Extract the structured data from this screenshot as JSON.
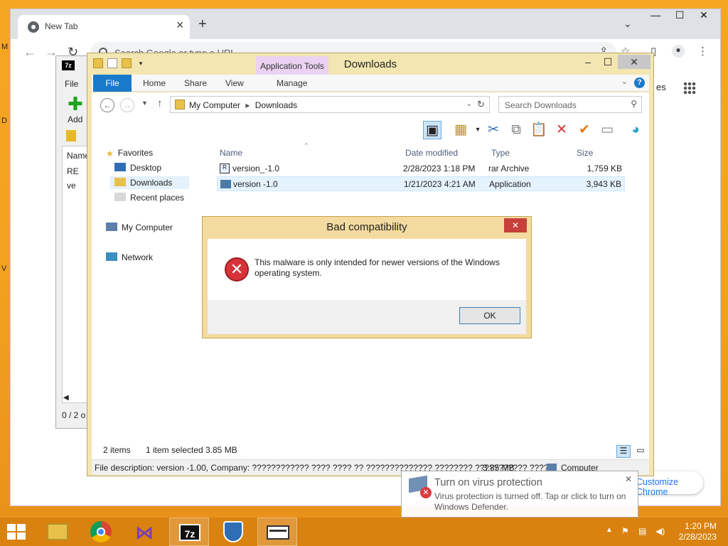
{
  "desktop": {
    "edge_letters": [
      "M",
      "D",
      "V"
    ]
  },
  "chrome": {
    "tab_title": "New Tab",
    "newtab_symbol": "+",
    "omnibox_placeholder": "Search Google or type a URL",
    "images_fragment": "es",
    "customize_label": "Customize Chrome"
  },
  "sevenzip": {
    "logo": "7z",
    "menu_file": "File",
    "add_label": "Add",
    "list_header": "Name",
    "row1": "RE",
    "row2": "ve",
    "status": "0 / 2 o"
  },
  "explorer": {
    "title": "Downloads",
    "context_tab": "Application Tools",
    "ribbon_tabs": {
      "file": "File",
      "home": "Home",
      "share": "Share",
      "view": "View",
      "manage": "Manage"
    },
    "breadcrumbs": [
      "My Computer",
      "Downloads"
    ],
    "search_placeholder": "Search Downloads",
    "nav": {
      "favorites": "Favorites",
      "desktop": "Desktop",
      "downloads": "Downloads",
      "recent": "Recent places",
      "computer": "My Computer",
      "network": "Network"
    },
    "columns": {
      "name": "Name",
      "date": "Date modified",
      "type": "Type",
      "size": "Size"
    },
    "files": [
      {
        "name": "version_-1.0",
        "date": "2/28/2023 1:18 PM",
        "type": "rar Archive",
        "size": "1,759 KB"
      },
      {
        "name": "version -1.0",
        "date": "1/21/2023 4:21 AM",
        "type": "Application",
        "size": "3,943 KB"
      }
    ],
    "status": {
      "items": "2 items",
      "selected": "1 item selected",
      "size": "3.85 MB"
    },
    "details": {
      "description": "File description: version -1.00, Company: ???????????? ???? ???? ?? ?????????????? ???????? ??????????? ?????",
      "size": "3.85 MB",
      "location": "Computer"
    }
  },
  "dialog": {
    "title": "Bad compatibility",
    "message": "This malware is only intended for newer versions of the Windows operating system.",
    "ok_label": "OK"
  },
  "toast": {
    "title": "Turn on virus protection",
    "body": "Virus protection is turned off. Tap or click to turn on Windows Defender."
  },
  "taskbar": {
    "apps": [
      "file-explorer",
      "chrome",
      "visual-studio",
      "7-zip",
      "windows-defender",
      "version-app"
    ],
    "time": "1:20 PM",
    "date": "2/28/2023"
  },
  "colors": {
    "desktop": "#f2a21f",
    "taskbar": "#d9820f",
    "ribbon_file": "#1979ca",
    "explorer_frame": "#f3e6b0",
    "dialog_frame": "#f3dba0",
    "error_red": "#d8333a"
  }
}
